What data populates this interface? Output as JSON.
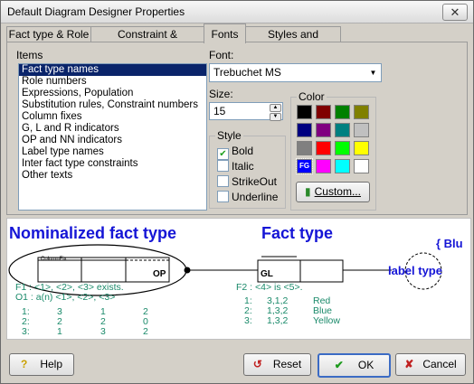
{
  "window": {
    "title": "Default Diagram Designer Properties",
    "close_icon": "close-icon"
  },
  "tabs": [
    {
      "label": "Fact type & Role"
    },
    {
      "label": "Constraint & Substitution"
    },
    {
      "label": "Fonts"
    },
    {
      "label": "Styles and selections"
    }
  ],
  "fonts": {
    "items_label": "Items",
    "items": [
      "Fact type names",
      "Role numbers",
      "Expressions, Population",
      "Substitution rules, Constraint numbers",
      "Column fixes",
      "G, L and R indicators",
      "OP and NN indicators",
      "Label type names",
      "Inter fact type constraints",
      "Other texts"
    ],
    "selected_item": "Fact type names",
    "font_label": "Font:",
    "font_value": "Trebuchet MS",
    "size_label": "Size:",
    "size_value": "15",
    "style_label": "Style",
    "style_options": [
      {
        "label": "Bold",
        "checked": true
      },
      {
        "label": "Italic",
        "checked": false
      },
      {
        "label": "StrikeOut",
        "checked": false
      },
      {
        "label": "Underline",
        "checked": false
      }
    ],
    "color_label": "Color",
    "colors": [
      "#000000",
      "#800000",
      "#008000",
      "#808000",
      "#000080",
      "#800080",
      "#008080",
      "#c0c0c0",
      "#808080",
      "#ff0000",
      "#00ff00",
      "#ffff00",
      "#0000ff",
      "#ff00ff",
      "#00ffff",
      "#ffffff"
    ],
    "fg_label": "FG",
    "custom_label": "Custom..."
  },
  "preview": {
    "nominalized_title": "Nominalized fact type",
    "fact_title": "Fact type",
    "label_type": "label type",
    "blu_text": "{ Blu",
    "columnfix": "ColumnFix",
    "op": "OP",
    "gl": "GL",
    "f1": "F1 : <1>, <2>, <3> exists.",
    "o1": "O1 : a(n) <1>, <2>, <3>",
    "f2": "F2 : <4> is <5>.",
    "left_rows": [
      [
        "1:",
        "3",
        "1",
        "2"
      ],
      [
        "2:",
        "2",
        "2",
        "0"
      ],
      [
        "3:",
        "1",
        "3",
        "2"
      ]
    ],
    "right_rows": [
      [
        "1:",
        "3,1,2",
        "Red"
      ],
      [
        "2:",
        "1,3,2",
        "Blue"
      ],
      [
        "3:",
        "1,3,2",
        "Yellow"
      ]
    ]
  },
  "buttons": {
    "help": "Help",
    "reset": "Reset",
    "ok": "OK",
    "cancel": "Cancel"
  }
}
